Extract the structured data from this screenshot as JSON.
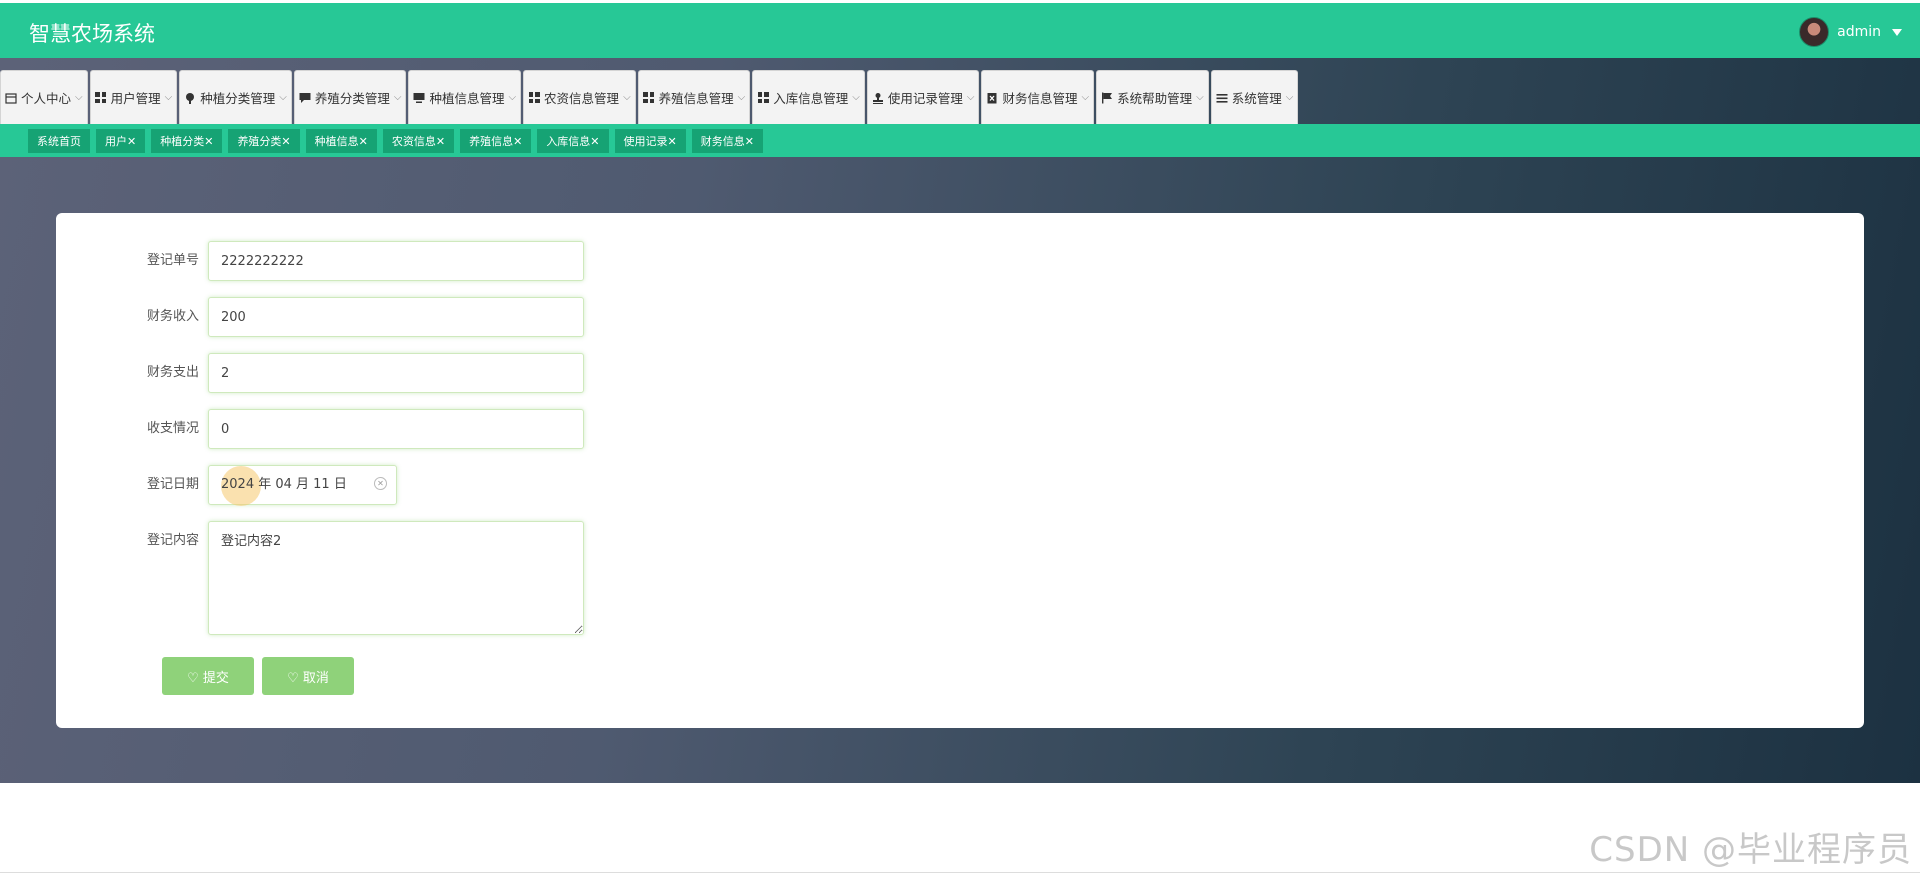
{
  "header": {
    "title": "智慧农场系统",
    "username": "admin"
  },
  "menu": [
    {
      "label": "个人中心",
      "icon": "calendar-icon"
    },
    {
      "label": "用户管理",
      "icon": "grid-icon"
    },
    {
      "label": "种植分类管理",
      "icon": "pin-icon"
    },
    {
      "label": "养殖分类管理",
      "icon": "chat-icon"
    },
    {
      "label": "种植信息管理",
      "icon": "monitor-icon"
    },
    {
      "label": "农资信息管理",
      "icon": "grid-icon"
    },
    {
      "label": "养殖信息管理",
      "icon": "grid-icon"
    },
    {
      "label": "入库信息管理",
      "icon": "grid-icon"
    },
    {
      "label": "使用记录管理",
      "icon": "stamp-icon"
    },
    {
      "label": "财务信息管理",
      "icon": "delete-box-icon"
    },
    {
      "label": "系统帮助管理",
      "icon": "flag-icon"
    },
    {
      "label": "系统管理",
      "icon": "list-icon"
    }
  ],
  "tabs": [
    {
      "label": "系统首页"
    },
    {
      "label": "用户✕"
    },
    {
      "label": "种植分类✕"
    },
    {
      "label": "养殖分类✕"
    },
    {
      "label": "种植信息✕"
    },
    {
      "label": "农资信息✕"
    },
    {
      "label": "养殖信息✕"
    },
    {
      "label": "入库信息✕"
    },
    {
      "label": "使用记录✕"
    },
    {
      "label": "财务信息✕"
    }
  ],
  "form": {
    "order_no": {
      "label": "登记单号",
      "value": "2222222222"
    },
    "income": {
      "label": "财务收入",
      "value": "200"
    },
    "expense": {
      "label": "财务支出",
      "value": "2"
    },
    "balance": {
      "label": "收支情况",
      "value": "0"
    },
    "date": {
      "label": "登记日期",
      "value": "2024 年 04 月 11 日"
    },
    "content": {
      "label": "登记内容",
      "value": "登记内容2"
    }
  },
  "buttons": {
    "submit": "♡ 提交",
    "cancel": "♡ 取消"
  },
  "watermark": "CSDN @毕业程序员",
  "colors": {
    "primary": "#27c896",
    "tab": "#16a374",
    "button": "#8fd27a"
  }
}
